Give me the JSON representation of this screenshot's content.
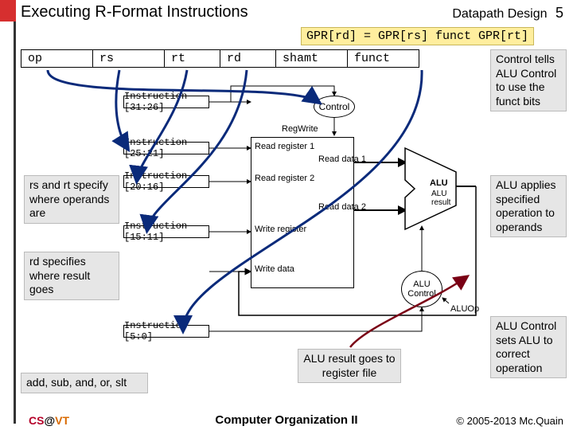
{
  "header": {
    "title": "Executing R-Format Instructions",
    "section": "Datapath Design",
    "page": "5"
  },
  "footer": {
    "left_cs": "CS",
    "left_at": "@",
    "left_vt": "VT",
    "center": "Computer Organization II",
    "right": "© 2005-2013 Mc.Quain"
  },
  "expression": "GPR[rd] = GPR[rs] funct GPR[rt]",
  "fields": {
    "op": "op",
    "rs": "rs",
    "rt": "rt",
    "rd": "rd",
    "shamt": "shamt",
    "funct": "funct"
  },
  "callouts": {
    "control_tells": "Control tells ALU Control to use the funct bits",
    "rs_rt": "rs and rt specify where operands are",
    "rd": "rd specifies where result goes",
    "ops": "add, sub, and, or, slt",
    "alu_applies": "ALU applies specified operation to operands",
    "alu_result": "ALU result goes to register file",
    "alu_ctrl": "ALU Control sets ALU to correct operation"
  },
  "diagram": {
    "instr_3126": "Instruction [31:26]",
    "instr_2521": "Instruction [25:21]",
    "instr_2016": "Instruction [20:16]",
    "instr_1511": "Instruction [15:11]",
    "instr_50": "Instruction [5:0]",
    "control": "Control",
    "regwrite": "RegWrite",
    "readreg1": "Read register 1",
    "readreg2": "Read register 2",
    "writereg": "Write register",
    "writedata": "Write data",
    "readdata1": "Read data 1",
    "readdata2": "Read data 2",
    "alu": "ALU",
    "alu_result": "ALU result",
    "alu_control": "ALU Control",
    "aluop": "ALUOp"
  }
}
